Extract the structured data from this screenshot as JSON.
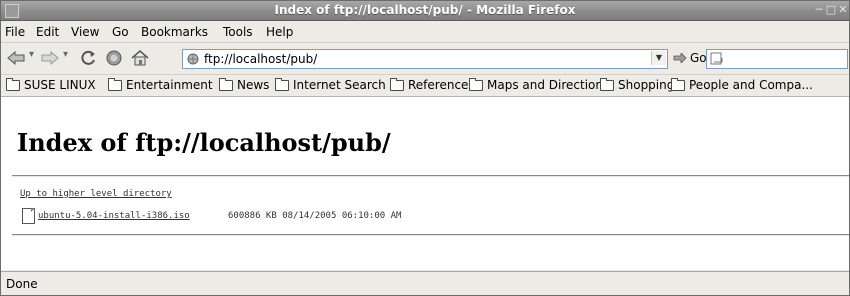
{
  "window": {
    "title": "Index of ftp://localhost/pub/ - Mozilla Firefox"
  },
  "menus": [
    "File",
    "Edit",
    "View",
    "Go",
    "Bookmarks",
    "Tools",
    "Help"
  ],
  "nav": {
    "url": "ftp://localhost/pub/",
    "go_label": "Go",
    "search_value": ""
  },
  "bookmarks": [
    "SUSE LINUX",
    "Entertainment",
    "News",
    "Internet Search",
    "Reference",
    "Maps and Directions",
    "Shopping",
    "People and Compa..."
  ],
  "page": {
    "heading": "Index of ftp://localhost/pub/",
    "up_link": "Up to higher level directory",
    "files": [
      {
        "name": "ubuntu-5.04-install-i386.iso",
        "size": "600886 KB",
        "date": "08/14/2005",
        "time": "06:10:00 AM"
      }
    ]
  },
  "status": {
    "text": "Done"
  },
  "colors": {
    "titlebar": "#8c8c8c",
    "chrome": "#ecebe6",
    "urlbar_border": "#7f9db9"
  }
}
